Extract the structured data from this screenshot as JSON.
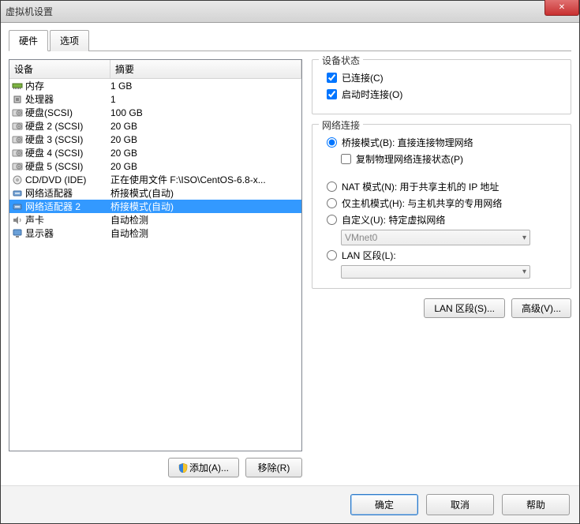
{
  "window": {
    "title": "虚拟机设置"
  },
  "tabs": {
    "hardware": "硬件",
    "options": "选项"
  },
  "device_list": {
    "col_device": "设备",
    "col_summary": "摘要",
    "rows": [
      {
        "icon": "memory",
        "label": "内存",
        "summary": "1 GB"
      },
      {
        "icon": "cpu",
        "label": "处理器",
        "summary": "1"
      },
      {
        "icon": "hdd",
        "label": "硬盘(SCSI)",
        "summary": "100 GB"
      },
      {
        "icon": "hdd",
        "label": "硬盘 2 (SCSI)",
        "summary": "20 GB"
      },
      {
        "icon": "hdd",
        "label": "硬盘 3 (SCSI)",
        "summary": "20 GB"
      },
      {
        "icon": "hdd",
        "label": "硬盘 4 (SCSI)",
        "summary": "20 GB"
      },
      {
        "icon": "hdd",
        "label": "硬盘 5 (SCSI)",
        "summary": "20 GB"
      },
      {
        "icon": "cd",
        "label": "CD/DVD (IDE)",
        "summary": "正在使用文件 F:\\ISO\\CentOS-6.8-x..."
      },
      {
        "icon": "net",
        "label": "网络适配器",
        "summary": "桥接模式(自动)"
      },
      {
        "icon": "net",
        "label": "网络适配器 2",
        "summary": "桥接模式(自动)",
        "selected": true
      },
      {
        "icon": "sound",
        "label": "声卡",
        "summary": "自动检测"
      },
      {
        "icon": "display",
        "label": "显示器",
        "summary": "自动检测"
      }
    ]
  },
  "left_buttons": {
    "add": "添加(A)...",
    "remove": "移除(R)"
  },
  "device_status": {
    "title": "设备状态",
    "connected": "已连接(C)",
    "connect_at_power_on": "启动时连接(O)"
  },
  "network": {
    "title": "网络连接",
    "bridged": "桥接模式(B): 直接连接物理网络",
    "replicate": "复制物理网络连接状态(P)",
    "nat": "NAT 模式(N): 用于共享主机的 IP 地址",
    "hostonly": "仅主机模式(H): 与主机共享的专用网络",
    "custom": "自定义(U): 特定虚拟网络",
    "custom_value": "VMnet0",
    "lan_segment": "LAN 区段(L):",
    "lan_value": ""
  },
  "right_buttons": {
    "lan_segments": "LAN 区段(S)...",
    "advanced": "高级(V)..."
  },
  "footer": {
    "ok": "确定",
    "cancel": "取消",
    "help": "帮助"
  }
}
